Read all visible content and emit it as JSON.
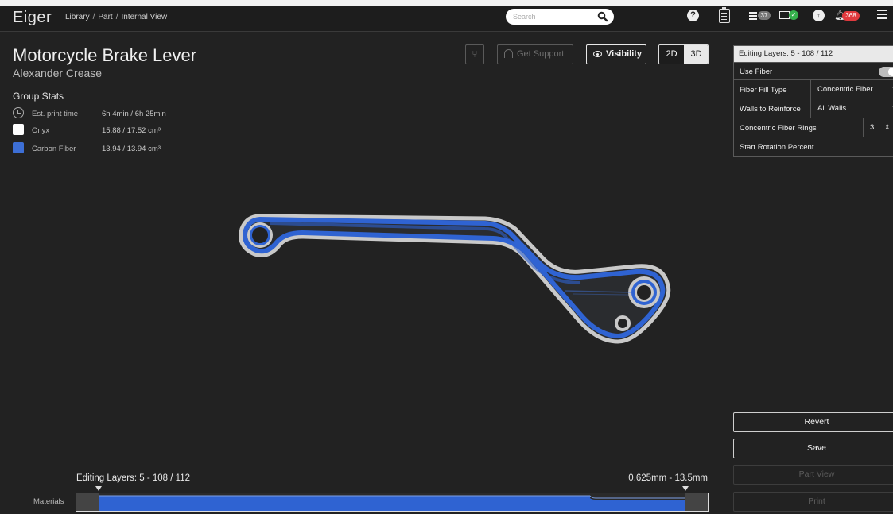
{
  "app": {
    "logo": "Eiger",
    "breadcrumb": [
      "Library",
      "Part",
      "Internal View"
    ],
    "breadcrumb_sep": "/"
  },
  "search": {
    "placeholder": "Search"
  },
  "header_badges": {
    "queue_count": "37",
    "notifications_count": "368"
  },
  "part": {
    "title": "Motorcycle Brake Lever",
    "author": "Alexander Crease"
  },
  "stats": {
    "heading": "Group Stats",
    "rows": [
      {
        "label": "Est. print time",
        "value": "6h 4min / 6h 25min",
        "icon": "clock-icon"
      },
      {
        "label": "Onyx",
        "value": "15.88 / 17.52 cm³",
        "color": "#ffffff"
      },
      {
        "label": "Carbon Fiber",
        "value": "13.94 / 13.94 cm³",
        "color": "#3d6fd6"
      }
    ]
  },
  "toolbar": {
    "branch_glyph": "⑂",
    "support_label": "Get Support",
    "visibility_label": "Visibility",
    "view_2d": "2D",
    "view_3d": "3D"
  },
  "panel": {
    "header": "Editing Layers: 5 - 108 / 112",
    "use_fiber_label": "Use Fiber",
    "fill_type_label": "Fiber Fill Type",
    "fill_type_value": "Concentric Fiber",
    "walls_label": "Walls to Reinforce",
    "walls_value": "All Walls",
    "rings_label": "Concentric Fiber Rings",
    "rings_value": "3",
    "rotation_label": "Start Rotation Percent",
    "rotation_value": ""
  },
  "actions": {
    "revert": "Revert",
    "save": "Save",
    "part_view": "Part View",
    "print": "Print"
  },
  "layers": {
    "editing_label": "Editing Layers: 5 - 108 / 112",
    "height_range": "0.625mm - 13.5mm",
    "materials_label": "Materials"
  },
  "colors": {
    "fiber": "#2f63d2",
    "onyx": "#ffffff",
    "background": "#222222"
  }
}
